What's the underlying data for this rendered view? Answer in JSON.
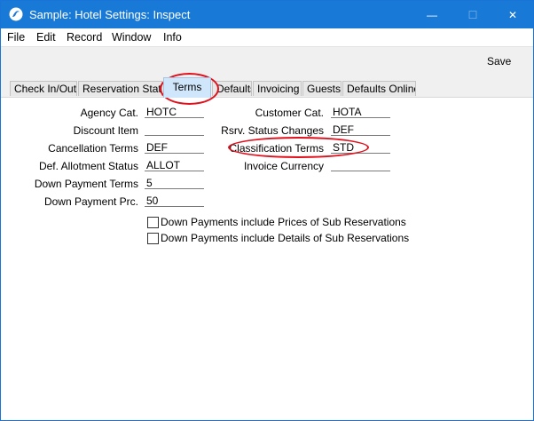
{
  "window": {
    "title": "Sample: Hotel Settings: Inspect",
    "buttons": {
      "minimize": "—",
      "maximize": "☐",
      "close": "✕"
    }
  },
  "menu": [
    "File",
    "Edit",
    "Record",
    "Window",
    "Info"
  ],
  "toolbar": {
    "save_label": "Save"
  },
  "tabs": [
    {
      "label": "Check In/Out",
      "active": false
    },
    {
      "label": "Reservation Status",
      "active": false
    },
    {
      "label": "Terms",
      "active": true
    },
    {
      "label": "Defaults",
      "active": false
    },
    {
      "label": "Invoicing",
      "active": false
    },
    {
      "label": "Guests",
      "active": false
    },
    {
      "label": "Defaults Online",
      "active": false
    }
  ],
  "left_fields": [
    {
      "label": "Agency Cat.",
      "value": "HOTC"
    },
    {
      "label": "Discount Item",
      "value": ""
    },
    {
      "label": "Cancellation Terms",
      "value": "DEF"
    },
    {
      "label": "Def. Allotment Status",
      "value": "ALLOT"
    },
    {
      "label": "Down Payment Terms",
      "value": "5"
    },
    {
      "label": "Down Payment Prc.",
      "value": "50"
    }
  ],
  "right_fields": [
    {
      "label": "Customer Cat.",
      "value": "HOTA"
    },
    {
      "label": "Rsrv. Status Changes",
      "value": "DEF"
    },
    {
      "label": "Classification Terms",
      "value": "STD"
    },
    {
      "label": "Invoice Currency",
      "value": ""
    }
  ],
  "checkboxes": [
    {
      "label": "Down Payments include Prices of Sub Reservations",
      "checked": false
    },
    {
      "label": "Down Payments include Details of Sub Reservations",
      "checked": false
    }
  ],
  "colors": {
    "titlebar": "#1979d6",
    "annotation": "#e0111d",
    "active_tab": "#d0e6fa"
  }
}
